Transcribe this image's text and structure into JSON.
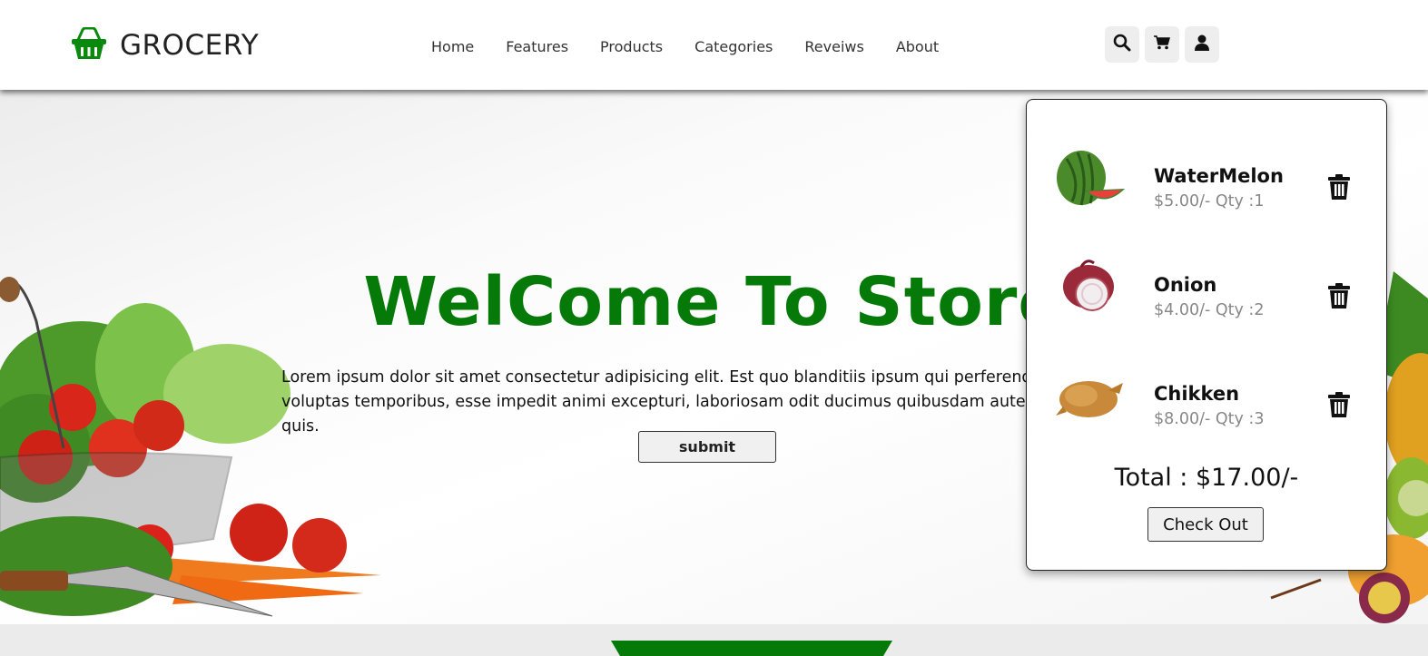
{
  "header": {
    "logo_text": "GROCERY",
    "nav": [
      "Home",
      "Features",
      "Products",
      "Categories",
      "Reveiws",
      "About"
    ],
    "icons": [
      "search-icon",
      "cart-icon",
      "user-icon"
    ]
  },
  "hero": {
    "title": "WelCome To Store",
    "text": "Lorem ipsum dolor sit amet consectetur adipisicing elit. Est quo blanditiis ipsum qui perferendis ipsam? Sint voluptas temporibus, esse impedit animi excepturi, laboriosam odit ducimus quibusdam autem minus in quis.",
    "button": "submit"
  },
  "cart": {
    "items": [
      {
        "name": "WaterMelon",
        "price": "$5.00/- Qty :1"
      },
      {
        "name": "Onion",
        "price": "$4.00/- Qty :2"
      },
      {
        "name": "Chikken",
        "price": "$8.00/- Qty :3"
      }
    ],
    "total": "Total : $17.00/-",
    "checkout": "Check Out"
  },
  "colors": {
    "brand_green": "#067a08"
  }
}
